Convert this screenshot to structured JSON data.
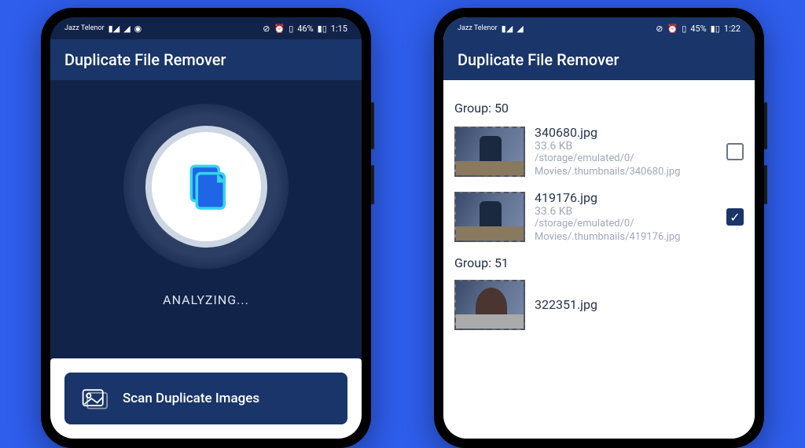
{
  "phone1": {
    "statusbar": {
      "carrier": "Jazz Telenor",
      "battery": "46%",
      "time": "1:15"
    },
    "app_title": "Duplicate File Remover",
    "status_text": "ANALYZING...",
    "scan_button": "Scan Duplicate Images"
  },
  "phone2": {
    "statusbar": {
      "carrier": "Jazz Telenor",
      "battery": "45%",
      "time": "1:22"
    },
    "app_title": "Duplicate File Remover",
    "groups": [
      {
        "label": "Group: 50",
        "files": [
          {
            "name": "340680.jpg",
            "size": "33.6 KB",
            "path1": "/storage/emulated/0/",
            "path2": "Movies/.thumbnails/340680.jpg",
            "checked": false
          },
          {
            "name": "419176.jpg",
            "size": "33.6 KB",
            "path1": "/storage/emulated/0/",
            "path2": "Movies/.thumbnails/419176.jpg",
            "checked": true
          }
        ]
      },
      {
        "label": "Group: 51",
        "files": [
          {
            "name": "322351.jpg",
            "size": "",
            "path1": "",
            "path2": "",
            "checked": false
          }
        ]
      }
    ]
  }
}
